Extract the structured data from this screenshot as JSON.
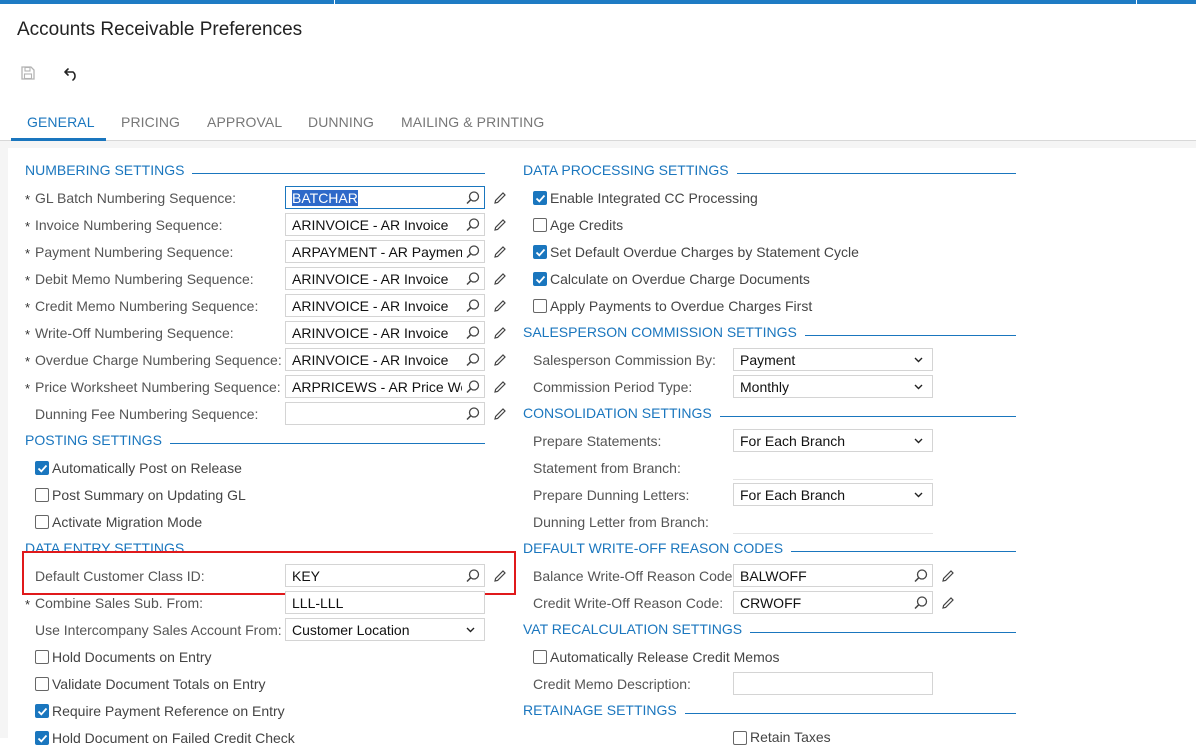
{
  "title": "Accounts Receivable Preferences",
  "toolbar": {
    "save_icon": "save-icon",
    "undo_icon": "undo-icon"
  },
  "tabs": [
    {
      "label": "GENERAL",
      "active": true
    },
    {
      "label": "PRICING"
    },
    {
      "label": "APPROVAL"
    },
    {
      "label": "DUNNING"
    },
    {
      "label": "MAILING & PRINTING"
    }
  ],
  "colors": {
    "accent": "#1a76be",
    "highlight": "#e0191b"
  },
  "numbering": {
    "title": "NUMBERING SETTINGS",
    "rows": [
      {
        "label": "GL Batch Numbering Sequence:",
        "value": "BATCHAR",
        "required": "*"
      },
      {
        "label": "Invoice Numbering Sequence:",
        "value": "ARINVOICE - AR Invoice",
        "required": "*"
      },
      {
        "label": "Payment Numbering Sequence:",
        "value": "ARPAYMENT - AR Payment",
        "required": "*"
      },
      {
        "label": "Debit Memo Numbering Sequence:",
        "value": "ARINVOICE - AR Invoice",
        "required": "*"
      },
      {
        "label": "Credit Memo Numbering Sequence:",
        "value": "ARINVOICE - AR Invoice",
        "required": "*"
      },
      {
        "label": "Write-Off Numbering Sequence:",
        "value": "ARINVOICE - AR Invoice",
        "required": "*"
      },
      {
        "label": "Overdue Charge Numbering Sequence:",
        "value": "ARINVOICE - AR Invoice",
        "required": "*"
      },
      {
        "label": "Price Worksheet Numbering Sequence:",
        "value": "ARPRICEWS - AR Price Worl",
        "required": "*"
      },
      {
        "label": "Dunning Fee Numbering Sequence:",
        "value": ""
      }
    ]
  },
  "posting": {
    "title": "POSTING SETTINGS",
    "checks": [
      {
        "label": "Automatically Post on Release",
        "checked": true
      },
      {
        "label": "Post Summary on Updating GL",
        "checked": false
      },
      {
        "label": "Activate Migration Mode",
        "checked": false
      }
    ]
  },
  "data_entry": {
    "title": "DATA ENTRY SETTINGS",
    "default_class_label": "Default Customer Class ID:",
    "default_class_value": "KEY",
    "combine_label": "Combine Sales Sub. From:",
    "combine_value": "LLL-LLL",
    "combine_required": "*",
    "intercompany_label": "Use Intercompany Sales Account From:",
    "intercompany_value": "Customer Location",
    "checks": [
      {
        "label": "Hold Documents on Entry",
        "checked": false
      },
      {
        "label": "Validate Document Totals on Entry",
        "checked": false
      },
      {
        "label": "Require Payment Reference on Entry",
        "checked": true
      },
      {
        "label": "Hold Document on Failed Credit Check",
        "checked": true
      }
    ]
  },
  "data_processing": {
    "title": "DATA PROCESSING SETTINGS",
    "checks": [
      {
        "label": "Enable Integrated CC Processing",
        "checked": true
      },
      {
        "label": "Age Credits",
        "checked": false
      },
      {
        "label": "Set Default Overdue Charges by Statement Cycle",
        "checked": true
      },
      {
        "label": "Calculate on Overdue Charge Documents",
        "checked": true
      },
      {
        "label": "Apply Payments to Overdue Charges First",
        "checked": false
      }
    ]
  },
  "commission": {
    "title": "SALESPERSON COMMISSION SETTINGS",
    "by_label": "Salesperson Commission By:",
    "by_value": "Payment",
    "period_label": "Commission Period Type:",
    "period_value": "Monthly"
  },
  "consolidation": {
    "title": "CONSOLIDATION SETTINGS",
    "prepare_statements_label": "Prepare Statements:",
    "prepare_statements_value": "For Each Branch",
    "statement_branch_label": "Statement from Branch:",
    "prepare_dunning_label": "Prepare Dunning Letters:",
    "prepare_dunning_value": "For Each Branch",
    "dunning_branch_label": "Dunning Letter from Branch:"
  },
  "writeoff": {
    "title": "DEFAULT WRITE-OFF REASON CODES",
    "balance_label": "Balance Write-Off Reason Code:",
    "balance_value": "BALWOFF",
    "credit_label": "Credit Write-Off Reason Code:",
    "credit_value": "CRWOFF"
  },
  "vat": {
    "title": "VAT RECALCULATION SETTINGS",
    "auto_release_label": "Automatically Release Credit Memos",
    "auto_release_checked": false,
    "credit_memo_desc_label": "Credit Memo Description:",
    "credit_memo_desc_value": ""
  },
  "retainage": {
    "title": "RETAINAGE SETTINGS",
    "retain_taxes_label": "Retain Taxes",
    "retain_taxes_checked": false
  }
}
